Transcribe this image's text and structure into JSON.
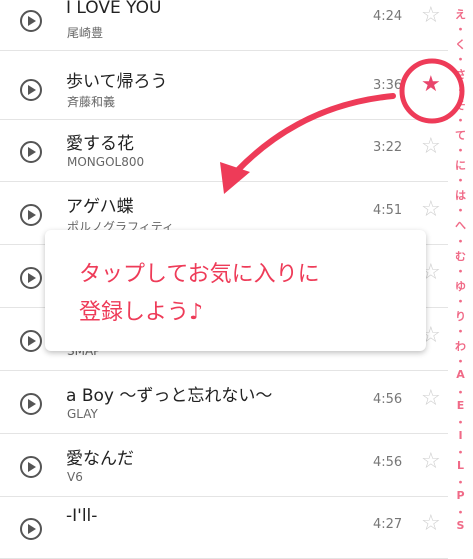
{
  "songs": [
    {
      "title": "I LOVE YOU",
      "artist": "尾崎豊",
      "duration": "4:24",
      "favorite": false
    },
    {
      "title": "歩いて帰ろう",
      "artist": "斉藤和義",
      "duration": "3:36",
      "favorite": true
    },
    {
      "title": "愛する花",
      "artist": "MONGOL800",
      "duration": "3:22",
      "favorite": false
    },
    {
      "title": "アゲハ蝶",
      "artist": "ポルノグラフィティ",
      "duration": "4:51",
      "favorite": false
    },
    {
      "title": "",
      "artist": "",
      "duration": "",
      "favorite": false
    },
    {
      "title": "",
      "artist": "SMAP",
      "duration": "",
      "favorite": false
    },
    {
      "title": "a Boy 〜ずっと忘れない〜",
      "artist": "GLAY",
      "duration": "4:56",
      "favorite": false
    },
    {
      "title": "愛なんだ",
      "artist": "V6",
      "duration": "4:56",
      "favorite": false
    },
    {
      "title": "-I'll-",
      "artist": "",
      "duration": "4:27",
      "favorite": false
    }
  ],
  "index": [
    "え",
    "・",
    "く",
    "・",
    "さ",
    "・",
    "そ",
    "・",
    "て",
    "・",
    "に",
    "・",
    "は",
    "・",
    "へ",
    "・",
    "む",
    "・",
    "ゆ",
    "・",
    "り",
    "・",
    "わ",
    "・",
    "A",
    "・",
    "E",
    "・",
    "I",
    "・",
    "L",
    "・",
    "P",
    "・",
    "S"
  ],
  "tooltip": {
    "line1": "タップしてお気に入りに",
    "line2": "登録しよう♪"
  },
  "icons": {
    "play": "play-circle-icon",
    "star_empty": "star-outline-icon",
    "star_filled": "star-filled-icon"
  },
  "colors": {
    "accent": "#ee3b58",
    "index": "#f06a87"
  }
}
